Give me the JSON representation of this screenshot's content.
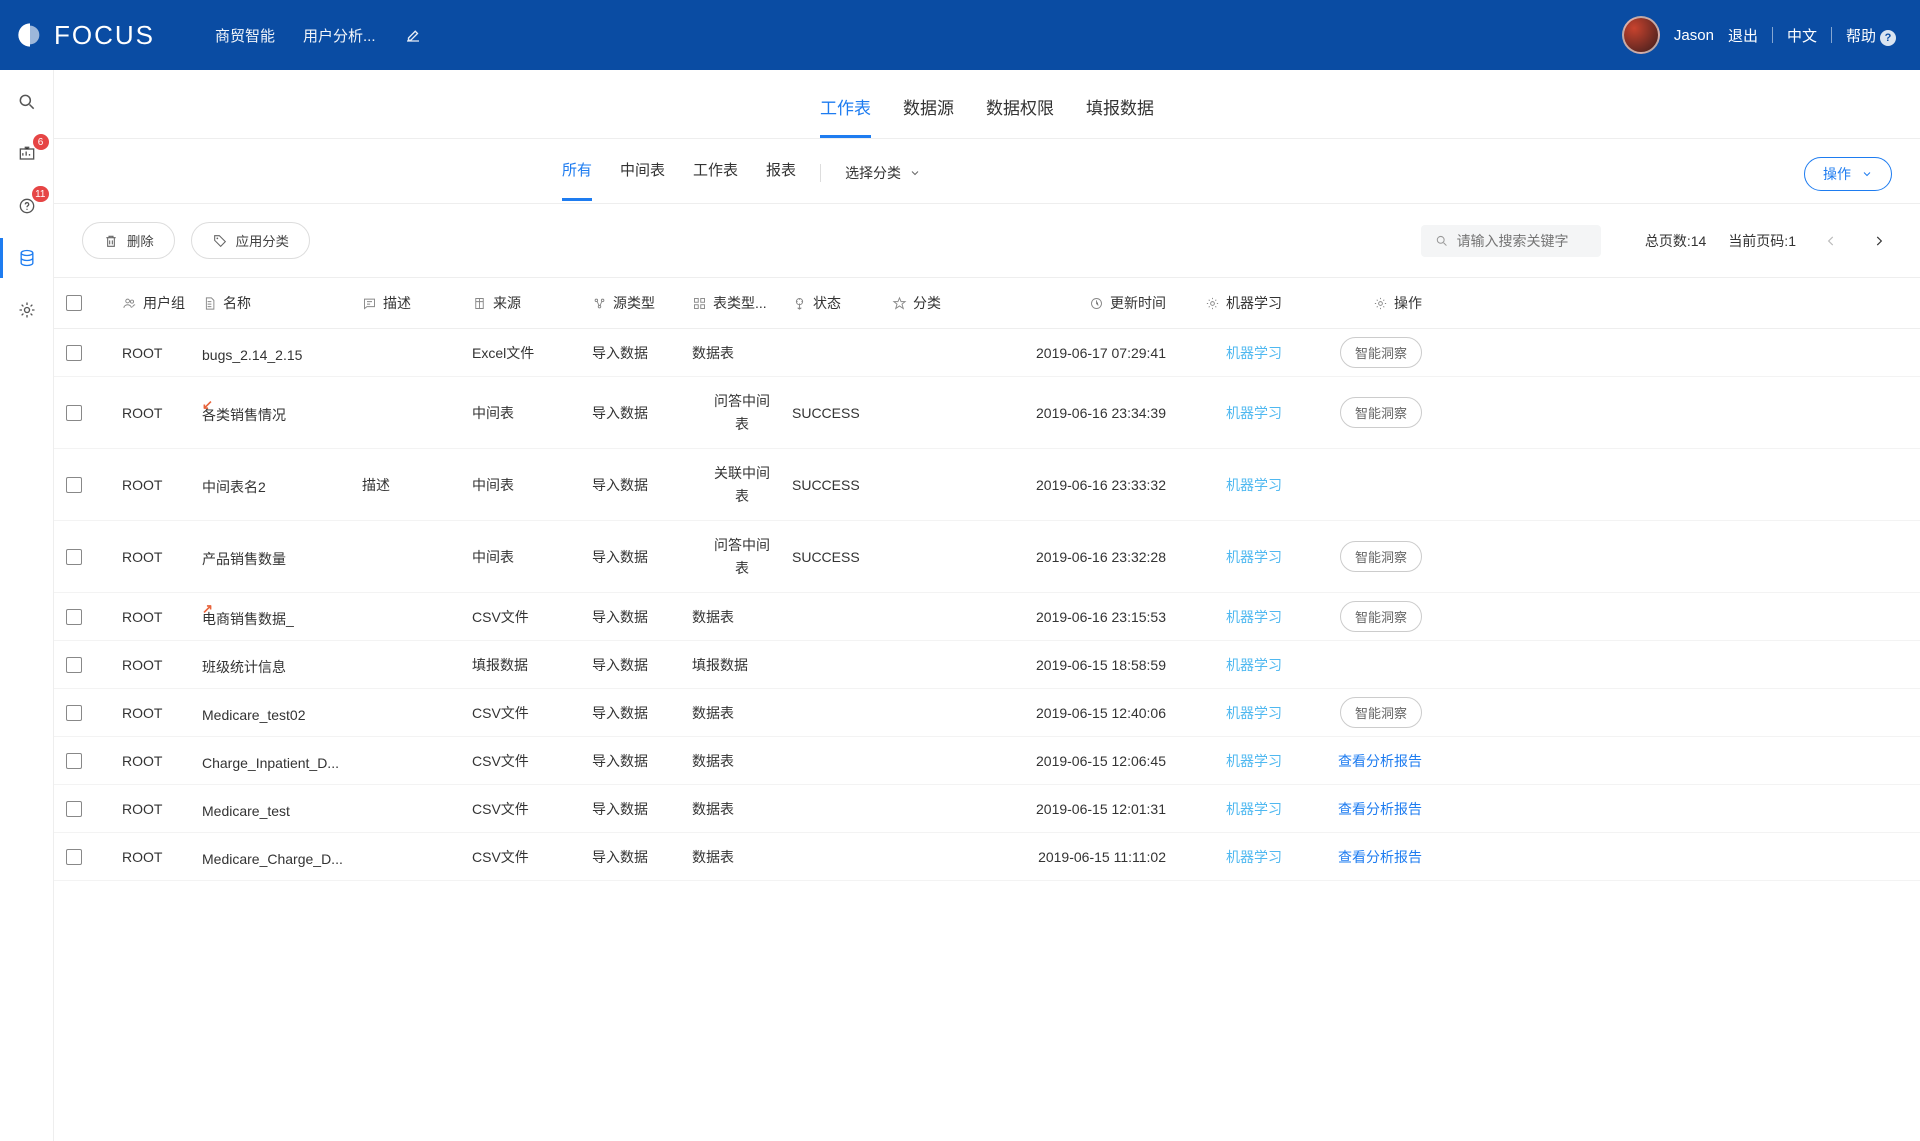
{
  "header": {
    "logo_text": "FOCUS",
    "nav": [
      "商贸智能",
      "用户分析..."
    ],
    "user": "Jason",
    "logout": "退出",
    "lang": "中文",
    "help": "帮助"
  },
  "sidebar": {
    "badge1": "6",
    "badge2": "11"
  },
  "tabs_primary": [
    {
      "label": "工作表",
      "active": true
    },
    {
      "label": "数据源",
      "active": false
    },
    {
      "label": "数据权限",
      "active": false
    },
    {
      "label": "填报数据",
      "active": false
    }
  ],
  "tabs_secondary": [
    {
      "label": "所有",
      "active": true
    },
    {
      "label": "中间表",
      "active": false
    },
    {
      "label": "工作表",
      "active": false
    },
    {
      "label": "报表",
      "active": false
    }
  ],
  "category_select": "选择分类",
  "action_dropdown": "操作",
  "toolbar": {
    "delete": "删除",
    "apply_category": "应用分类",
    "search_placeholder": "请输入搜索关键字",
    "total_pages_label": "总页数:14",
    "current_page_label": "当前页码:1"
  },
  "columns": {
    "usergroup": "用户组",
    "name": "名称",
    "desc": "描述",
    "source": "来源",
    "source_type": "源类型",
    "table_type": "表类型...",
    "status": "状态",
    "category": "分类",
    "updated": "更新时间",
    "ml": "机器学习",
    "op": "操作"
  },
  "ml_link": "机器学习",
  "pill_insight": "智能洞察",
  "link_report": "查看分析报告",
  "rows": [
    {
      "ug": "ROOT",
      "name": "bugs_2.14_2.15",
      "desc": "",
      "source": "Excel文件",
      "stype": "导入数据",
      "ttype": "数据表",
      "status": "",
      "updated": "2019-06-17 07:29:41",
      "arrow": "",
      "op": "pill"
    },
    {
      "ug": "ROOT",
      "name": "各类销售情况",
      "desc": "",
      "source": "中间表",
      "stype": "导入数据",
      "ttype": "问答中间表",
      "status": "SUCCESS",
      "updated": "2019-06-16 23:34:39",
      "arrow": "down",
      "op": "pill"
    },
    {
      "ug": "ROOT",
      "name": "中间表名2",
      "desc": "描述",
      "source": "中间表",
      "stype": "导入数据",
      "ttype": "关联中间表",
      "status": "SUCCESS",
      "updated": "2019-06-16 23:33:32",
      "arrow": "",
      "op": ""
    },
    {
      "ug": "ROOT",
      "name": "产品销售数量",
      "desc": "",
      "source": "中间表",
      "stype": "导入数据",
      "ttype": "问答中间表",
      "status": "SUCCESS",
      "updated": "2019-06-16 23:32:28",
      "arrow": "",
      "op": "pill"
    },
    {
      "ug": "ROOT",
      "name": "电商销售数据_",
      "desc": "",
      "source": "CSV文件",
      "stype": "导入数据",
      "ttype": "数据表",
      "status": "",
      "updated": "2019-06-16 23:15:53",
      "arrow": "up",
      "op": "pill"
    },
    {
      "ug": "ROOT",
      "name": "班级统计信息",
      "desc": "",
      "source": "填报数据",
      "stype": "导入数据",
      "ttype": "填报数据",
      "status": "",
      "updated": "2019-06-15 18:58:59",
      "arrow": "",
      "op": ""
    },
    {
      "ug": "ROOT",
      "name": "Medicare_test02",
      "desc": "",
      "source": "CSV文件",
      "stype": "导入数据",
      "ttype": "数据表",
      "status": "",
      "updated": "2019-06-15 12:40:06",
      "arrow": "",
      "op": "pill"
    },
    {
      "ug": "ROOT",
      "name": "Charge_Inpatient_D...",
      "desc": "",
      "source": "CSV文件",
      "stype": "导入数据",
      "ttype": "数据表",
      "status": "",
      "updated": "2019-06-15 12:06:45",
      "arrow": "",
      "op": "link"
    },
    {
      "ug": "ROOT",
      "name": "Medicare_test",
      "desc": "",
      "source": "CSV文件",
      "stype": "导入数据",
      "ttype": "数据表",
      "status": "",
      "updated": "2019-06-15 12:01:31",
      "arrow": "",
      "op": "link"
    },
    {
      "ug": "ROOT",
      "name": "Medicare_Charge_D...",
      "desc": "",
      "source": "CSV文件",
      "stype": "导入数据",
      "ttype": "数据表",
      "status": "",
      "updated": "2019-06-15 11:11:02",
      "arrow": "",
      "op": "link"
    }
  ]
}
